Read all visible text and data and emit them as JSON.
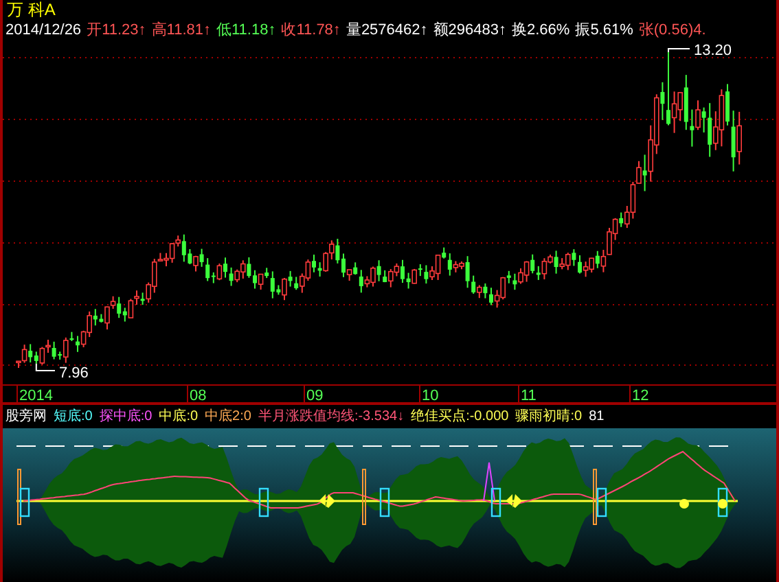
{
  "stock": {
    "title": "万 科A"
  },
  "quote": {
    "date": "2014/12/26",
    "items": [
      {
        "label": "开",
        "value": "11.23",
        "arrow": "↑",
        "color": "#ff5555"
      },
      {
        "label": "高",
        "value": "11.81",
        "arrow": "↑",
        "color": "#ff5555"
      },
      {
        "label": "低",
        "value": "11.18",
        "arrow": "↑",
        "color": "#55ff55"
      },
      {
        "label": "收",
        "value": "11.78",
        "arrow": "↑",
        "color": "#ff5555"
      },
      {
        "label": "量",
        "value": "2576462",
        "arrow": "↑",
        "color": "#ffffff"
      },
      {
        "label": "额",
        "value": "296483",
        "arrow": "↑",
        "color": "#ffffff"
      },
      {
        "label": "换",
        "value": "2.66%",
        "color": "#ffffff"
      },
      {
        "label": "振",
        "value": "5.61%",
        "color": "#ffffff"
      },
      {
        "label": "张",
        "value": "(0.56)4.",
        "color": "#ff5555"
      }
    ]
  },
  "price_chart": {
    "high_label": "13.20",
    "low_label": "7.96",
    "months": [
      "2014",
      "08",
      "09",
      "10",
      "11",
      "12"
    ]
  },
  "indicator": {
    "items": [
      {
        "text": "股旁网",
        "color": "#ffffff"
      },
      {
        "text": "短底:0",
        "color": "#55ffff"
      },
      {
        "text": "探中底:0",
        "color": "#ff55ff"
      },
      {
        "text": "中底:0",
        "color": "#ffff55"
      },
      {
        "text": "中底2:0",
        "color": "#ffaa55"
      },
      {
        "text": "半月涨跌值均线:-3.534↓",
        "color": "#ff5577"
      },
      {
        "text": "绝佳买点:-0.000",
        "color": "#ffff55"
      },
      {
        "text": "骤雨初晴:0",
        "color": "#ffff55"
      },
      {
        "text": "81",
        "color": "#ffffff"
      }
    ]
  }
}
